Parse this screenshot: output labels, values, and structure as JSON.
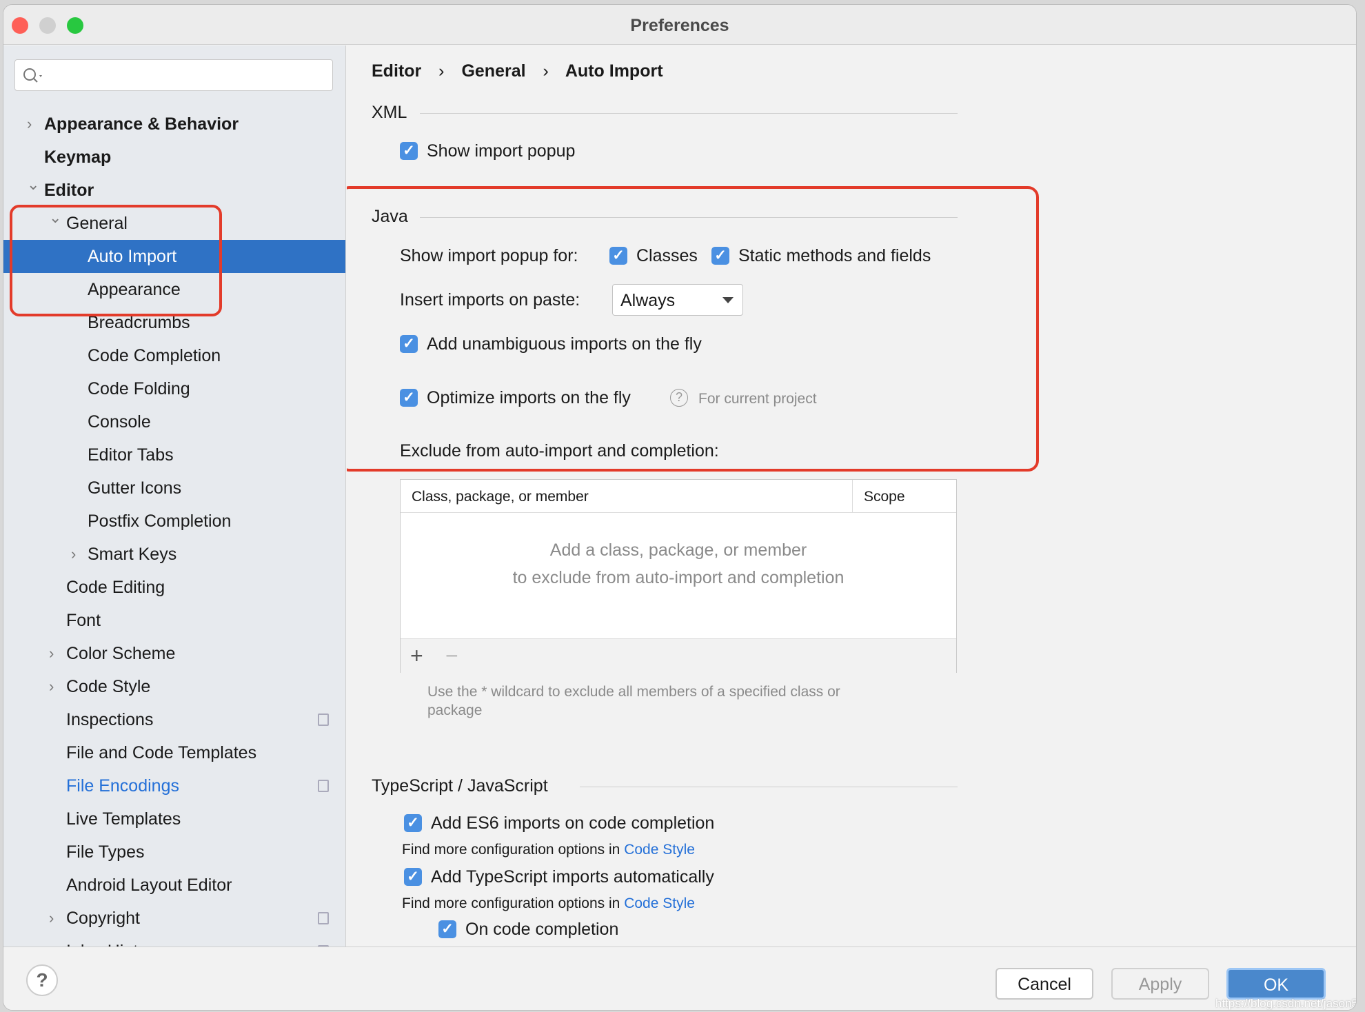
{
  "window": {
    "title": "Preferences"
  },
  "search": {
    "placeholder": "",
    "icon": "search-icon"
  },
  "sidebar": {
    "items": [
      {
        "label": "Appearance & Behavior",
        "level": 0,
        "chevron": "right",
        "bold": true
      },
      {
        "label": "Keymap",
        "level": 0,
        "chevron": "none",
        "bold": true
      },
      {
        "label": "Editor",
        "level": 0,
        "chevron": "down",
        "bold": true
      },
      {
        "label": "General",
        "level": 1,
        "chevron": "down"
      },
      {
        "label": "Auto Import",
        "level": 2,
        "chevron": "none",
        "selected": true
      },
      {
        "label": "Appearance",
        "level": 2,
        "chevron": "none"
      },
      {
        "label": "Breadcrumbs",
        "level": 2,
        "chevron": "none"
      },
      {
        "label": "Code Completion",
        "level": 2,
        "chevron": "none"
      },
      {
        "label": "Code Folding",
        "level": 2,
        "chevron": "none"
      },
      {
        "label": "Console",
        "level": 2,
        "chevron": "none"
      },
      {
        "label": "Editor Tabs",
        "level": 2,
        "chevron": "none"
      },
      {
        "label": "Gutter Icons",
        "level": 2,
        "chevron": "none"
      },
      {
        "label": "Postfix Completion",
        "level": 2,
        "chevron": "none"
      },
      {
        "label": "Smart Keys",
        "level": 2,
        "chevron": "right"
      },
      {
        "label": "Code Editing",
        "level": 1,
        "chevron": "none"
      },
      {
        "label": "Font",
        "level": 1,
        "chevron": "none"
      },
      {
        "label": "Color Scheme",
        "level": 1,
        "chevron": "right"
      },
      {
        "label": "Code Style",
        "level": 1,
        "chevron": "right"
      },
      {
        "label": "Inspections",
        "level": 1,
        "chevron": "none",
        "copy": true
      },
      {
        "label": "File and Code Templates",
        "level": 1,
        "chevron": "none"
      },
      {
        "label": "File Encodings",
        "level": 1,
        "chevron": "none",
        "copy": true,
        "link": true
      },
      {
        "label": "Live Templates",
        "level": 1,
        "chevron": "none"
      },
      {
        "label": "File Types",
        "level": 1,
        "chevron": "none"
      },
      {
        "label": "Android Layout Editor",
        "level": 1,
        "chevron": "none"
      },
      {
        "label": "Copyright",
        "level": 1,
        "chevron": "right",
        "copy": true
      },
      {
        "label": "Inlay Hints",
        "level": 1,
        "chevron": "right",
        "copy": true
      }
    ]
  },
  "breadcrumb": [
    "Editor",
    "General",
    "Auto Import"
  ],
  "xml": {
    "title": "XML",
    "show_import_popup": {
      "label": "Show import popup",
      "checked": true
    }
  },
  "java": {
    "title": "Java",
    "show_popup_for_label": "Show import popup for:",
    "classes": {
      "label": "Classes",
      "checked": true
    },
    "static": {
      "label": "Static methods and fields",
      "checked": true
    },
    "insert_on_paste_label": "Insert imports on paste:",
    "insert_on_paste_value": "Always",
    "unambiguous": {
      "label": "Add unambiguous imports on the fly",
      "checked": true
    },
    "optimize": {
      "label": "Optimize imports on the fly",
      "checked": true,
      "note": "For current project"
    },
    "exclude_label": "Exclude from auto-import and completion:",
    "table": {
      "columns": [
        "Class, package, or member",
        "Scope"
      ],
      "empty_line1": "Add a class, package, or member",
      "empty_line2": "to exclude from auto-import and completion",
      "add": "+",
      "remove": "−"
    },
    "hint_line1": "Use the * wildcard to exclude all members of a specified class or",
    "hint_line2": "package"
  },
  "ts": {
    "title": "TypeScript / JavaScript",
    "es6": {
      "label": "Add ES6 imports on code completion",
      "checked": true
    },
    "find_more": "Find more configuration options in",
    "code_style_link": "Code Style",
    "ts_auto": {
      "label": "Add TypeScript imports automatically",
      "checked": true
    },
    "on_completion": {
      "label": "On code completion",
      "checked": true
    }
  },
  "buttons": {
    "help": "?",
    "cancel": "Cancel",
    "apply": "Apply",
    "ok": "OK"
  },
  "watermark": "https://blog.csdn.net/jason559",
  "colors": {
    "accent": "#2f72c5",
    "checkbox": "#4a90e2",
    "highlight": "#e33b2a",
    "link": "#2470d8"
  }
}
